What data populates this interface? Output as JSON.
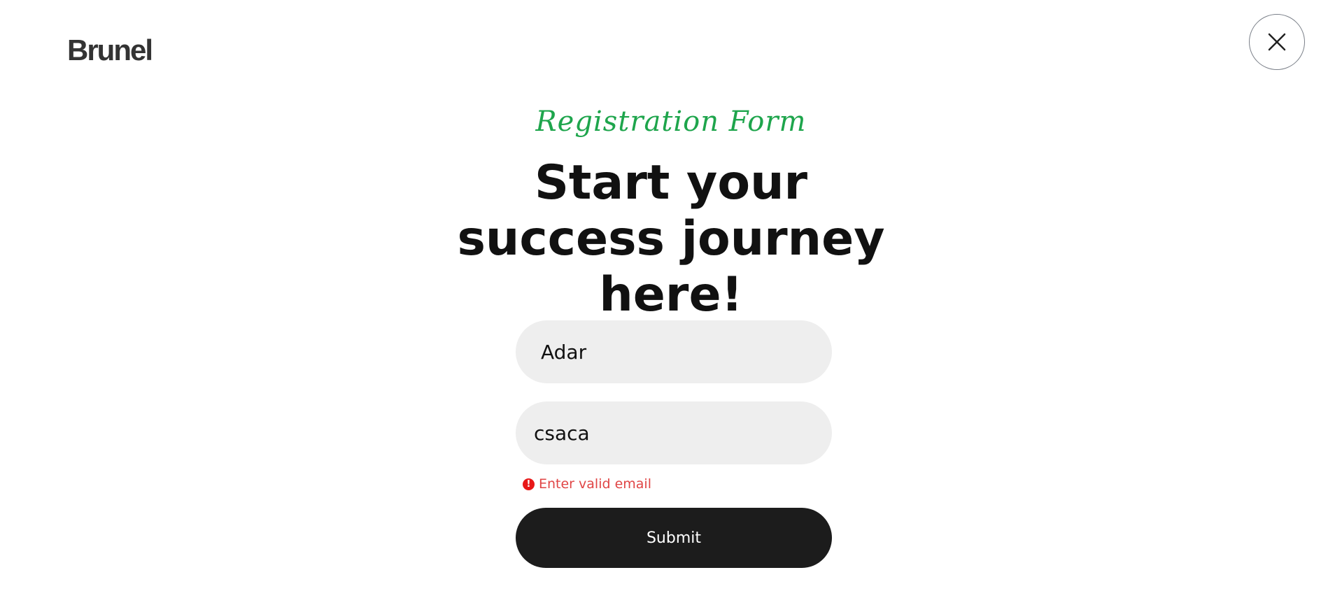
{
  "header": {
    "logo_text": "Brunel",
    "close_icon": "close-icon"
  },
  "hero": {
    "kicker": "Registration Form",
    "heading": "Start your success journey here!"
  },
  "form": {
    "name_value": "Adar",
    "email_value": "csaca",
    "email_error": "Enter valid email",
    "error_icon": "exclamation-icon",
    "submit_label": "Submit"
  },
  "colors": {
    "accent": "#1ea54c",
    "error": "#e04545",
    "button_bg": "#1c1c1c",
    "field_bg": "#eeeeee"
  }
}
